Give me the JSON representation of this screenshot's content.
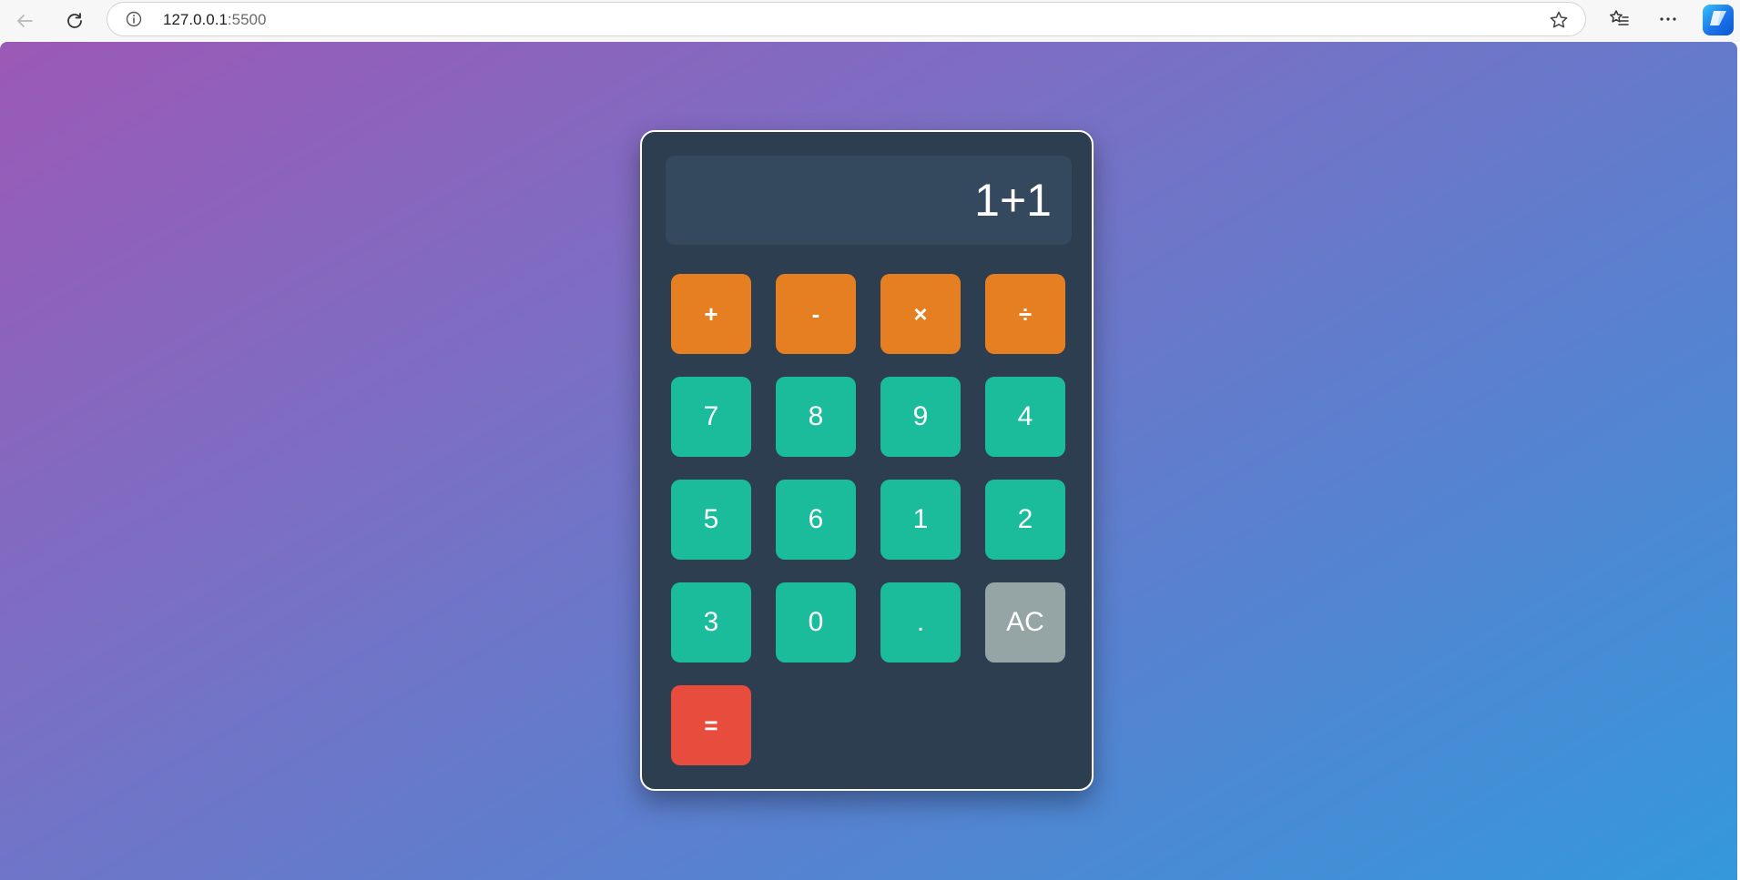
{
  "browser": {
    "url_host": "127.0.0.1",
    "url_port": ":5500"
  },
  "calculator": {
    "display": "1+1",
    "keys": [
      {
        "label": "+",
        "type": "operator"
      },
      {
        "label": "-",
        "type": "operator"
      },
      {
        "label": "×",
        "type": "operator"
      },
      {
        "label": "÷",
        "type": "operator"
      },
      {
        "label": "7",
        "type": "number"
      },
      {
        "label": "8",
        "type": "number"
      },
      {
        "label": "9",
        "type": "number"
      },
      {
        "label": "4",
        "type": "number"
      },
      {
        "label": "5",
        "type": "number"
      },
      {
        "label": "6",
        "type": "number"
      },
      {
        "label": "1",
        "type": "number"
      },
      {
        "label": "2",
        "type": "number"
      },
      {
        "label": "3",
        "type": "number"
      },
      {
        "label": "0",
        "type": "number"
      },
      {
        "label": ".",
        "type": "number"
      },
      {
        "label": "AC",
        "type": "clear"
      },
      {
        "label": "=",
        "type": "equals"
      }
    ]
  },
  "colors": {
    "calculator_body": "#2c3e50",
    "display_bg": "#34495e",
    "operator_key": "#e67e22",
    "number_key": "#1abc9c",
    "clear_key": "#95a5a6",
    "equals_key": "#e74c3c",
    "gradient_start": "#9b59b6",
    "gradient_end": "#3498db"
  },
  "icons": {
    "back": "arrow-left-icon",
    "reload": "refresh-icon",
    "site_info": "info-icon",
    "favorite": "star-icon",
    "favorites_list": "favorites-list-icon",
    "menu": "more-icon",
    "copilot": "copilot-icon"
  }
}
